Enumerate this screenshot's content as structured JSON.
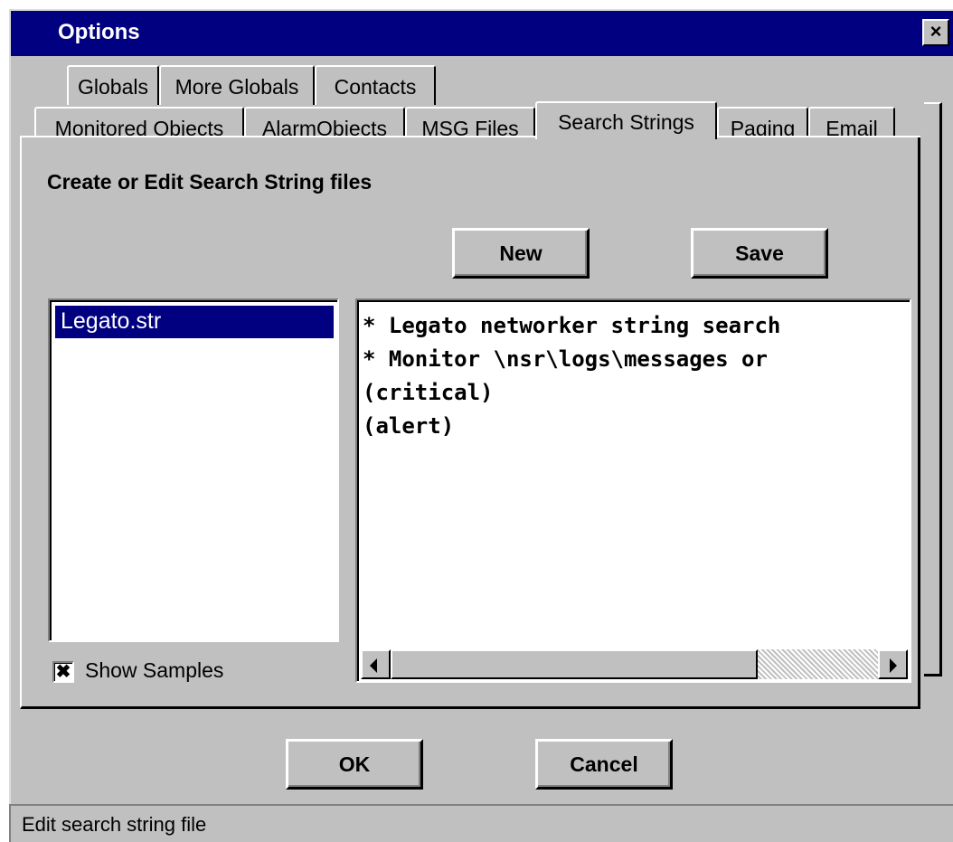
{
  "window": {
    "title": "Options",
    "close_glyph": "×"
  },
  "tabs_row1": [
    {
      "label": "Globals"
    },
    {
      "label": "More Globals"
    },
    {
      "label": "Contacts"
    }
  ],
  "tabs_row2": [
    {
      "label": "Monitored Objects"
    },
    {
      "label": "AlarmObjects"
    },
    {
      "label": "MSG Files"
    },
    {
      "label": "Search Strings",
      "selected": true
    },
    {
      "label": "Paging"
    },
    {
      "label": "Email"
    }
  ],
  "panel": {
    "heading": "Create or Edit Search String files",
    "new_button": "New",
    "save_button": "Save",
    "files": [
      {
        "name": "Legato.str",
        "selected": true
      }
    ],
    "editor_lines": [
      "* Legato networker string search",
      "* Monitor \\nsr\\logs\\messages or",
      "(critical)",
      "(alert)"
    ],
    "show_samples": {
      "label": "Show Samples",
      "checked": true,
      "mark": "✖"
    }
  },
  "footer": {
    "ok_button": "OK",
    "cancel_button": "Cancel"
  },
  "status": {
    "text": "Edit search string file"
  }
}
